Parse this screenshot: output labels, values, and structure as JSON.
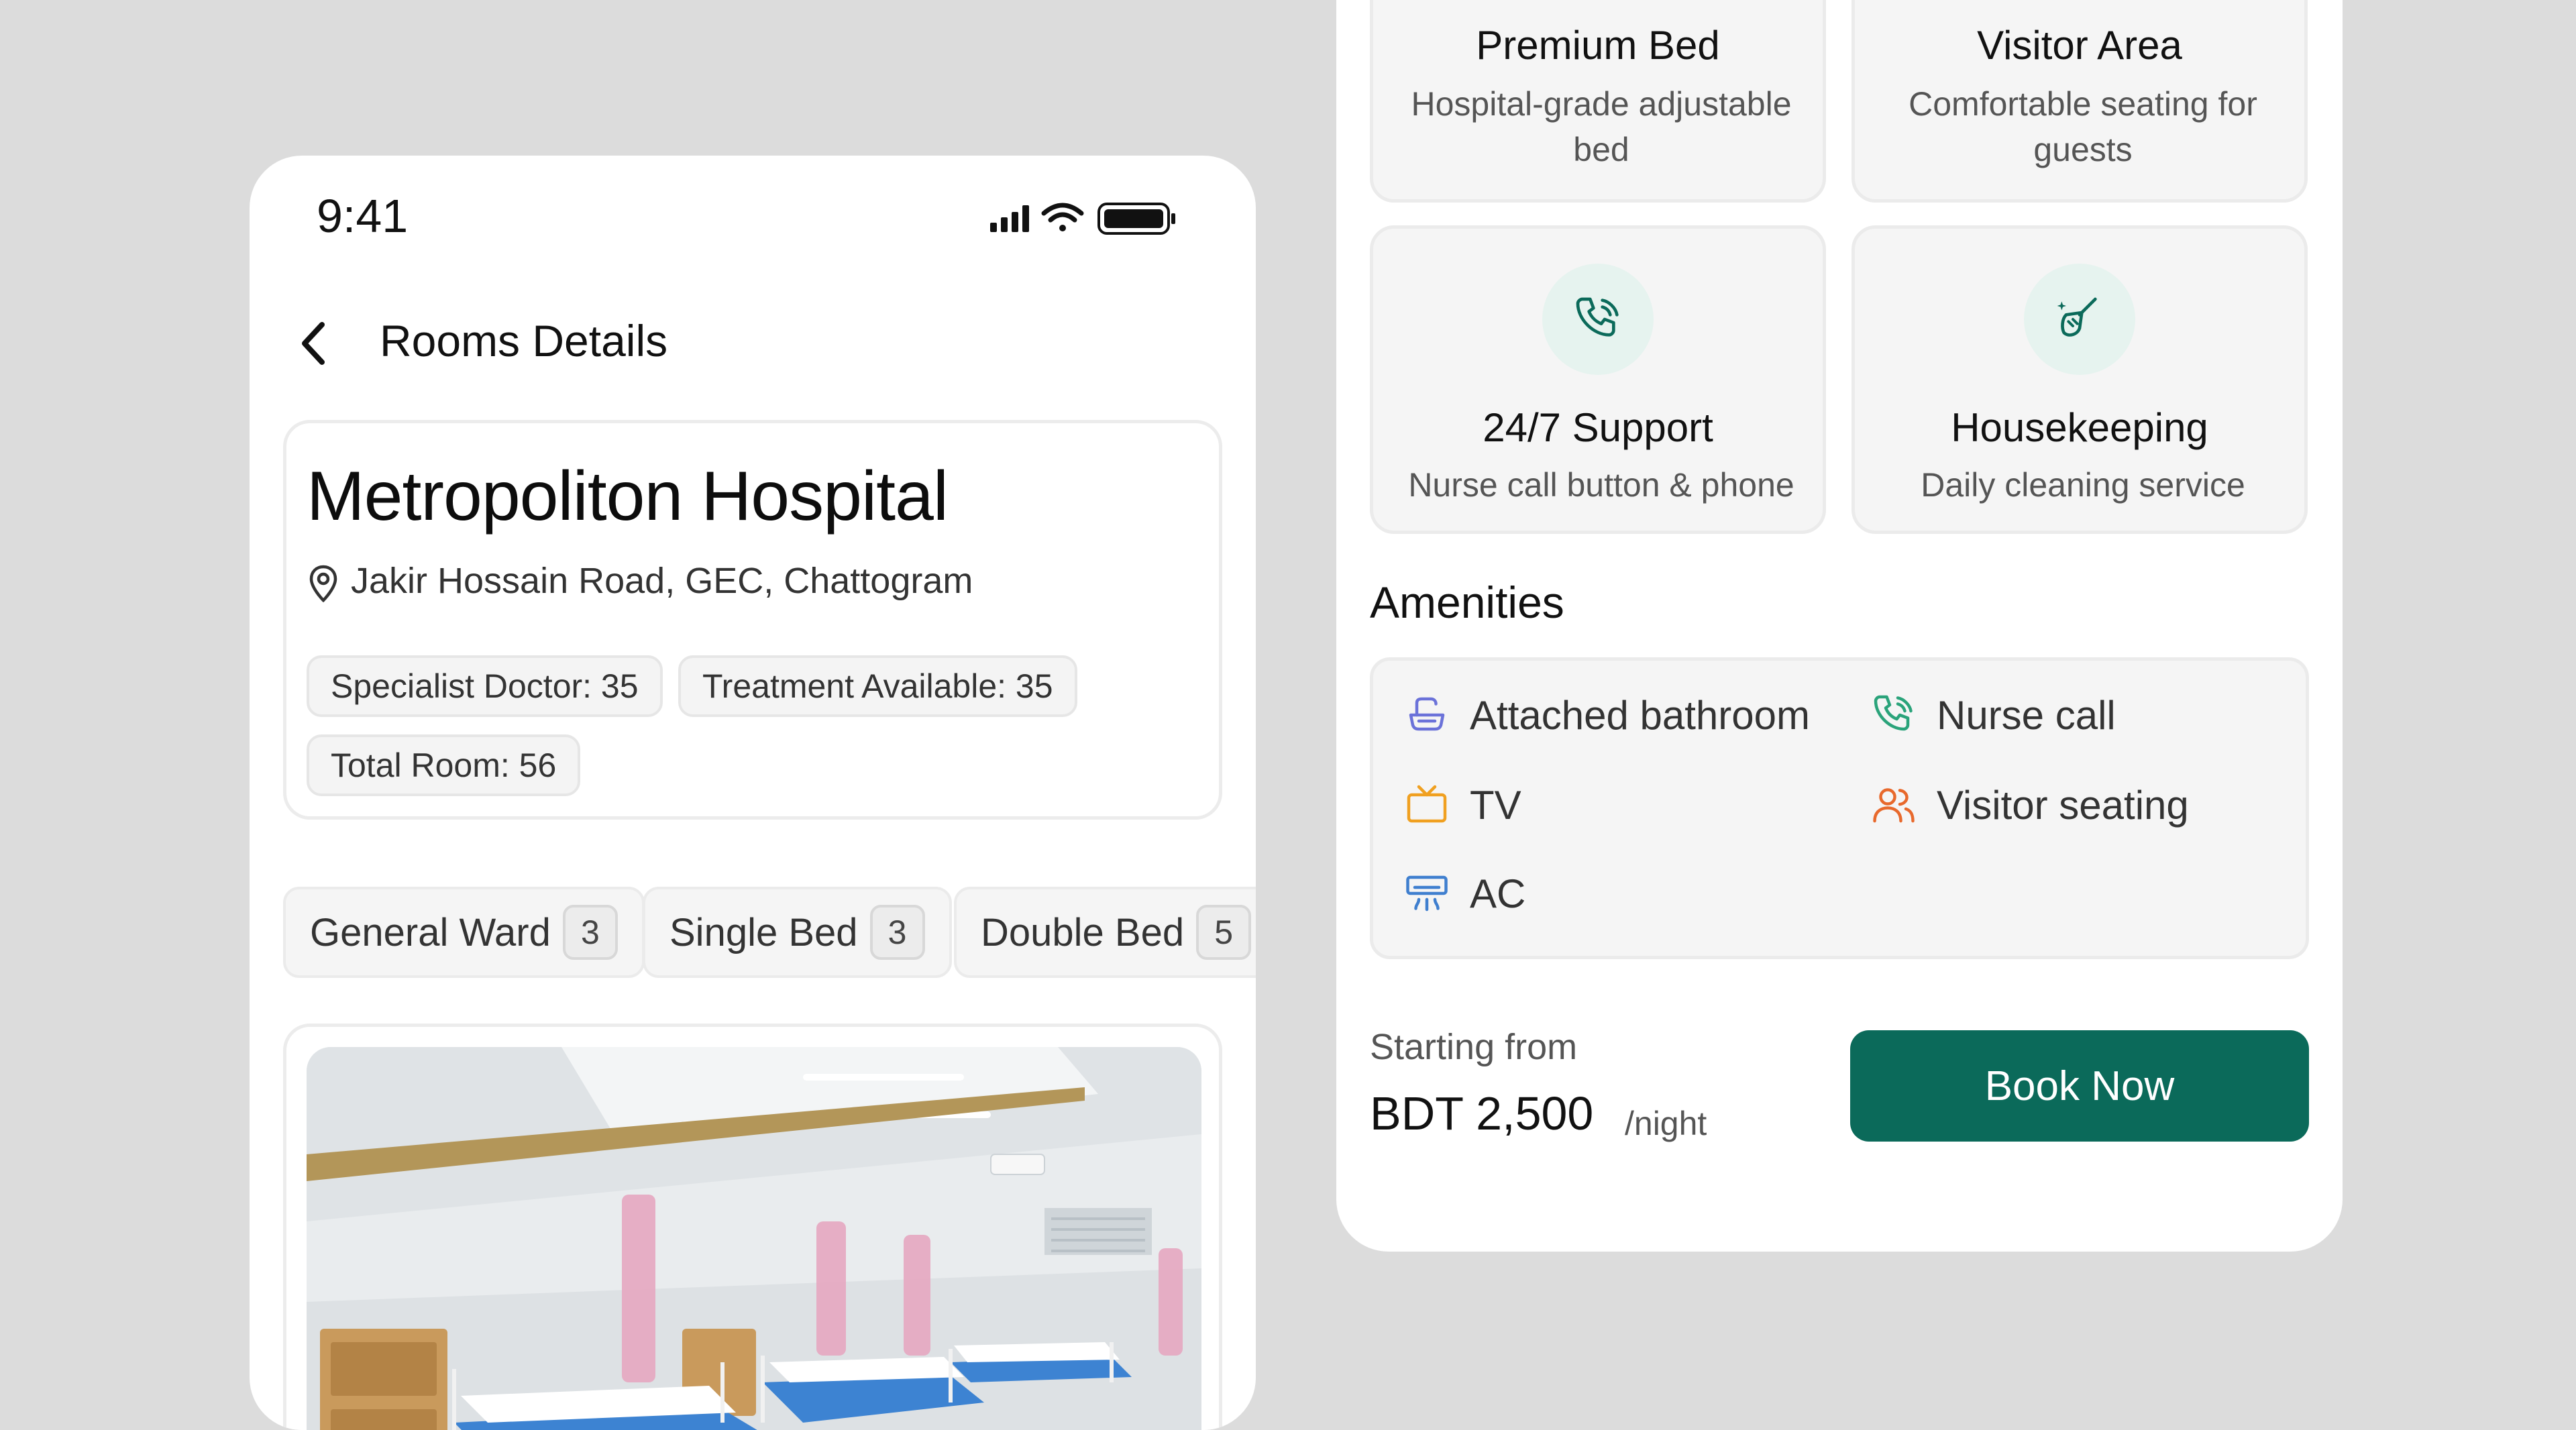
{
  "status_bar": {
    "time": "9:41"
  },
  "header": {
    "title": "Rooms Details"
  },
  "hospital": {
    "name": "Metropoliton Hospital",
    "address": "Jakir Hossain Road, GEC, Chattogram",
    "stats": [
      {
        "label": "Specialist Doctor: 35"
      },
      {
        "label": "Treatment Available: 35"
      },
      {
        "label": "Total  Room: 56"
      }
    ]
  },
  "room_tabs": [
    {
      "label": "General Ward",
      "count": "3"
    },
    {
      "label": "Single Bed",
      "count": "3"
    },
    {
      "label": "Double Bed",
      "count": "5"
    }
  ],
  "features": [
    {
      "title": "Premium Bed",
      "desc": "Hospital-grade adjustable bed",
      "icon": "bed-icon"
    },
    {
      "title": "Visitor Area",
      "desc": "Comfortable seating for guests",
      "icon": "seating-icon"
    },
    {
      "title": "24/7 Support",
      "desc": "Nurse call button & phone",
      "icon": "phone-ring-icon"
    },
    {
      "title": "Housekeeping",
      "desc": "Daily cleaning service",
      "icon": "broom-icon"
    }
  ],
  "amenities": {
    "title": "Amenities",
    "items": [
      {
        "label": "Attached bathroom",
        "icon": "bathtub-icon",
        "color": "#6b72d9"
      },
      {
        "label": "Nurse call",
        "icon": "phone-ring-icon",
        "color": "#2aa37a"
      },
      {
        "label": "TV",
        "icon": "tv-icon",
        "color": "#f0a020"
      },
      {
        "label": "Visitor seating",
        "icon": "users-icon",
        "color": "#e8692c"
      },
      {
        "label": "AC",
        "icon": "ac-icon",
        "color": "#3f7fcf"
      }
    ]
  },
  "pricing": {
    "label": "Starting from",
    "value": "BDT 2,500",
    "unit": "/night"
  },
  "cta": {
    "label": "Book Now"
  },
  "colors": {
    "primary": "#0b6a5a",
    "icon_bg": "#e6f3ef",
    "card_bg": "#f5f5f5"
  }
}
